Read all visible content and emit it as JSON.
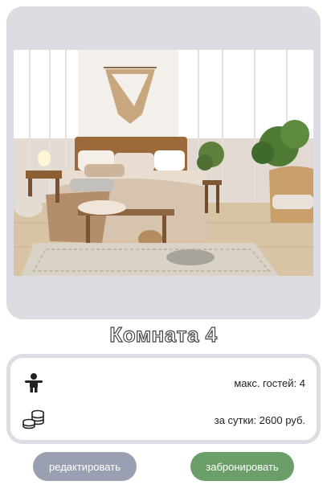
{
  "room": {
    "title": "Комната 4"
  },
  "details": {
    "guests_label": "макс. гостей: 4",
    "price_label": "за сутки: 2600 руб."
  },
  "actions": {
    "edit_label": "редактировать",
    "book_label": "забронировать"
  },
  "icons": {
    "guests": "person-icon",
    "price": "coins-icon"
  },
  "colors": {
    "card_bg": "#dcdde2",
    "edit_button": "#9aa0b1",
    "book_button": "#6c9e69"
  }
}
